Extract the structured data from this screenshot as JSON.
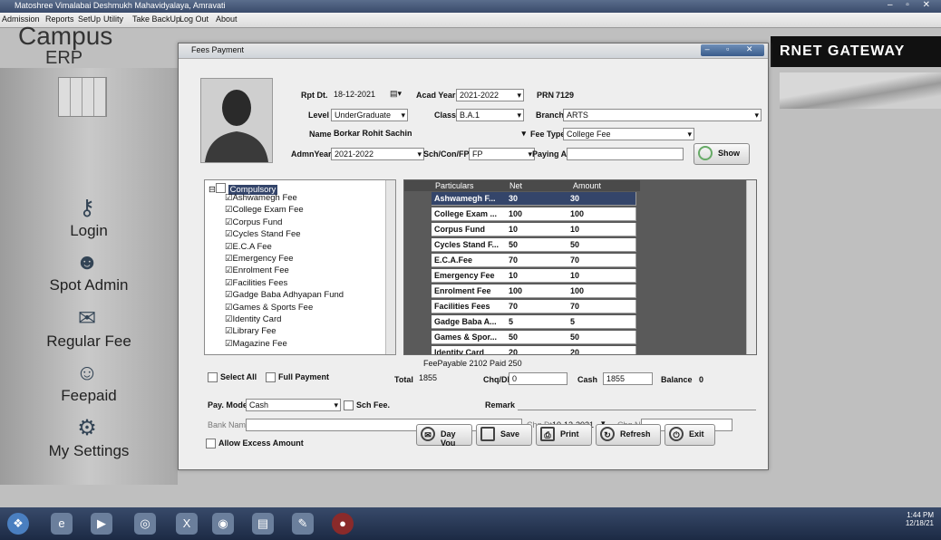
{
  "app": {
    "title": "Matoshree Vimalabai Deshmukh Mahavidyalaya, Amravati",
    "window_buttons": "– ▫ ✕",
    "menu": [
      "Admission",
      "Reports",
      "SetUp",
      "Utility",
      "Take BackUp",
      "Log Out",
      "About"
    ],
    "logo_top": "Campus",
    "logo_bottom": "ERP",
    "banner": "RNET GATEWAY"
  },
  "nav": [
    {
      "label": "Login",
      "icon": "key-icon"
    },
    {
      "label": "Spot Admin",
      "icon": "users-icon"
    },
    {
      "label": "Regular Fee",
      "icon": "fee-icon"
    },
    {
      "label": "Feepaid",
      "icon": "people-icon"
    },
    {
      "label": "My Settings",
      "icon": "settings-icon"
    }
  ],
  "window": {
    "title": "Fees Payment",
    "controls": "– ▫ ✕"
  },
  "form": {
    "rpt_dt_label": "Rpt Dt.",
    "rpt_dt": "18-12-2021",
    "acad_year_label": "Acad Year",
    "acad_year": "2021-2022",
    "prn_label": "PRN",
    "prn": "7129",
    "level_label": "Level",
    "level": "UnderGraduate",
    "class_label": "Class",
    "class": "B.A.1",
    "branch_label": "Branch",
    "branch": "ARTS",
    "name_label": "Name",
    "name": "Borkar Rohit Sachin",
    "fee_type_label": "Fee Type",
    "fee_type": "College Fee",
    "admn_year_label": "AdmnYear",
    "admn_year": "2021-2022",
    "sch_con_label": "Sch/Con/FP",
    "sch_con": "FP",
    "paying_amt_label": "Paying Amt",
    "show_button": "Show"
  },
  "tree": {
    "root": "Compulsory",
    "items": [
      "Ashwamegh Fee",
      "College Exam Fee",
      "Corpus Fund",
      "Cycles Stand Fee",
      "E.C.A Fee",
      "Emergency Fee",
      "Enrolment Fee",
      "Facilities Fees",
      "Gadge Baba Adhyapan Fund",
      "Games & Sports Fee",
      "Identity Card",
      "Library Fee",
      "Magazine Fee"
    ]
  },
  "grid": {
    "columns": [
      "Particulars",
      "Net",
      "Amount"
    ],
    "rows": [
      [
        "Ashwamegh F...",
        "30",
        "30"
      ],
      [
        "College Exam ...",
        "100",
        "100"
      ],
      [
        "Corpus Fund",
        "10",
        "10"
      ],
      [
        "Cycles Stand F...",
        "50",
        "50"
      ],
      [
        "E.C.A.Fee",
        "70",
        "70"
      ],
      [
        "Emergency Fee",
        "10",
        "10"
      ],
      [
        "Enrolment Fee",
        "100",
        "100"
      ],
      [
        "Facilities Fees",
        "70",
        "70"
      ],
      [
        "Gadge Baba A...",
        "5",
        "5"
      ],
      [
        "Games & Spor...",
        "50",
        "50"
      ],
      [
        "Identity Card",
        "20",
        "20"
      ]
    ]
  },
  "summary": {
    "fee_payable": "FeePayable 2102 Paid 250",
    "select_all": "Select All",
    "full_payment": "Full Payment",
    "total_label": "Total",
    "total": "1855",
    "chq_label": "Chq/DD",
    "chq": "0",
    "cash_label": "Cash",
    "cash": "1855",
    "balance_label": "Balance",
    "balance": "0"
  },
  "payment": {
    "pay_mode_label": "Pay. Mode",
    "pay_mode": "Cash",
    "sch_fee": "Sch Fee.",
    "remark_label": "Remark",
    "bank_name_label": "Bank Name",
    "chq_dt_label": "Chq Dt",
    "chq_dt": "10-12-2021",
    "chq_no_label": "Chq No",
    "allow_excess": "Allow Excess Amount"
  },
  "buttons": {
    "day_vou": "Day Vou",
    "save": "Save",
    "print": "Print",
    "refresh": "Refresh",
    "exit": "Exit"
  },
  "tray": {
    "time": "1:44 PM",
    "date": "12/18/21"
  }
}
